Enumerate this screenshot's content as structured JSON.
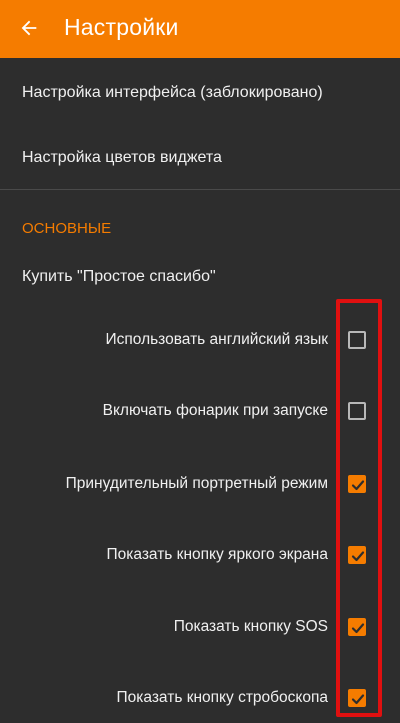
{
  "appbar": {
    "title": "Настройки",
    "back_icon": "arrow-back-icon",
    "color": "#f57c00"
  },
  "items": {
    "interface": "Настройка интерфейса (заблокировано)",
    "widget_colors": "Настройка цветов виджета"
  },
  "section": {
    "title": "ОСНОВНЫЕ"
  },
  "buy": "Купить \"Простое спасибо\"",
  "checkboxes": [
    {
      "label": "Использовать английский язык",
      "checked": false
    },
    {
      "label": "Включать фонарик при запуске",
      "checked": false
    },
    {
      "label": "Принудительный портретный режим",
      "checked": true
    },
    {
      "label": "Показать кнопку яркого экрана",
      "checked": true
    },
    {
      "label": "Показать кнопку SOS",
      "checked": true
    },
    {
      "label": "Показать кнопку стробоскопа",
      "checked": true
    }
  ],
  "colors": {
    "accent": "#f57c00",
    "background": "#2d2d2d",
    "highlight": "#e01010"
  }
}
